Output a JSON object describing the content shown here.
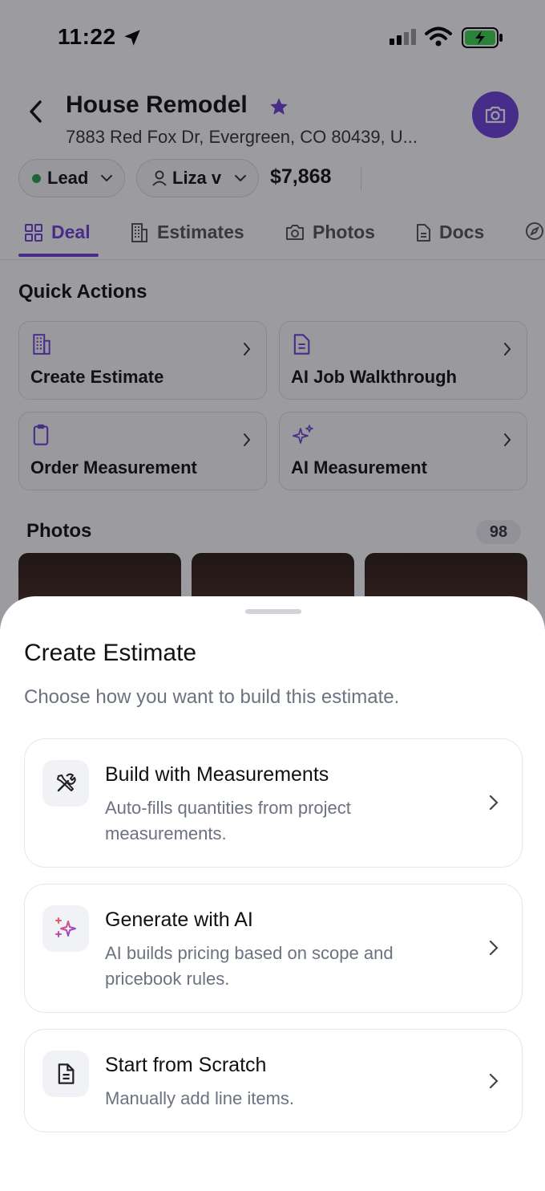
{
  "status_bar": {
    "time": "11:22"
  },
  "header": {
    "title": "House Remodel",
    "address": "7883 Red Fox Dr, Evergreen, CO 80439, U..."
  },
  "chips": {
    "status": "Lead",
    "user": "Liza v",
    "amount": "$7,868"
  },
  "tabs": [
    "Deal",
    "Estimates",
    "Photos",
    "Docs"
  ],
  "quick_actions": {
    "title": "Quick Actions",
    "items": [
      {
        "label": "Create Estimate",
        "icon": "building-icon"
      },
      {
        "label": "AI Job Walkthrough",
        "icon": "document-icon"
      },
      {
        "label": "Order Measurement",
        "icon": "clipboard-icon"
      },
      {
        "label": "AI Measurement",
        "icon": "sparkles-icon"
      }
    ]
  },
  "photos": {
    "title": "Photos",
    "count": "98"
  },
  "sheet": {
    "title": "Create Estimate",
    "subtitle": "Choose how you want to build this estimate.",
    "options": [
      {
        "title": "Build with Measurements",
        "description": "Auto-fills quantities from project measurements.",
        "icon": "tools-icon"
      },
      {
        "title": "Generate with AI",
        "description": "AI builds pricing based on scope and pricebook rules.",
        "icon": "ai-sparkle-icon"
      },
      {
        "title": "Start from Scratch",
        "description": "Manually add line items.",
        "icon": "file-icon"
      }
    ]
  },
  "colors": {
    "accent": "#6d3fd8",
    "lead_dot": "#22a04a",
    "overlay": "rgba(20,20,28,0.42)"
  }
}
